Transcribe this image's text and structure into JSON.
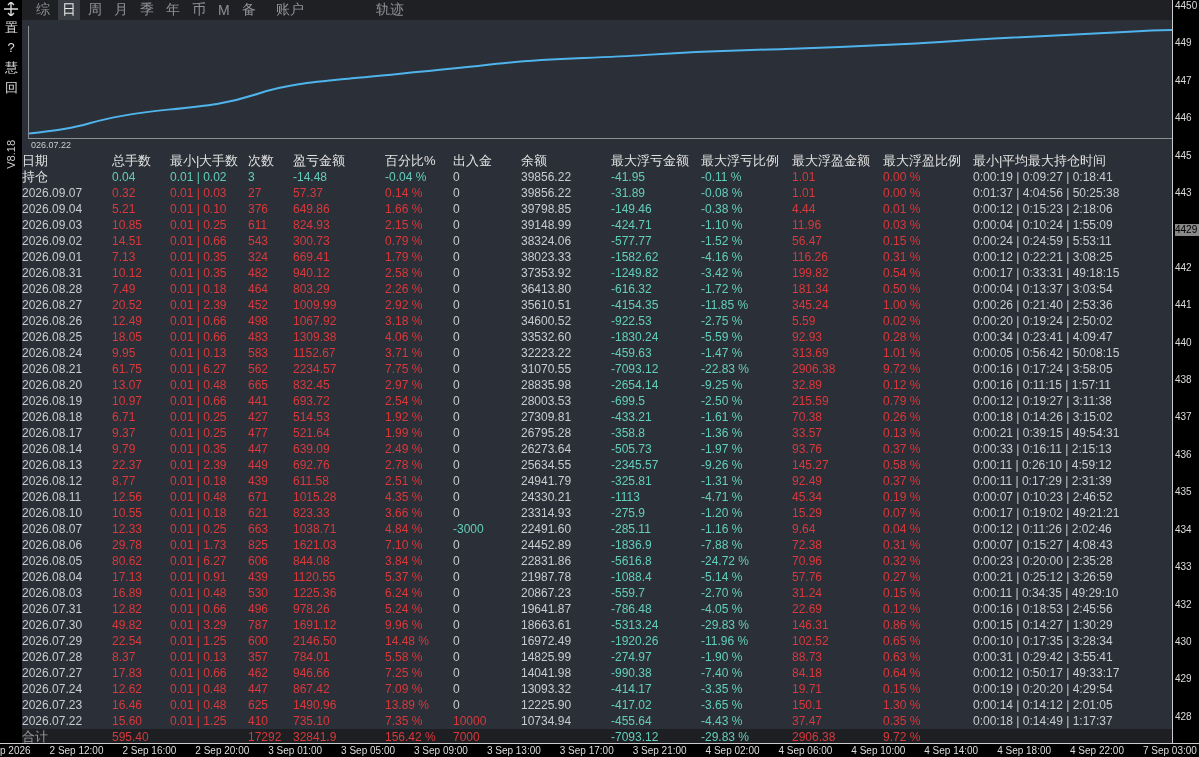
{
  "tabs": [
    {
      "label": "综",
      "selected": false
    },
    {
      "label": "日",
      "selected": true
    },
    {
      "label": "周",
      "selected": false
    },
    {
      "label": "月",
      "selected": false
    },
    {
      "label": "季",
      "selected": false
    },
    {
      "label": "年",
      "selected": false
    },
    {
      "label": "币",
      "selected": false
    },
    {
      "label": "M",
      "selected": false
    },
    {
      "label": "备",
      "selected": false
    },
    {
      "label": "账户",
      "selected": false
    },
    {
      "label": "轨迹",
      "selected": false
    }
  ],
  "left_toolbar": [
    "置",
    "?",
    "慧",
    "回"
  ],
  "version": "V8.18",
  "chart": {
    "start_label": "026.07.22"
  },
  "table": {
    "columns": [
      "日期",
      "总手数",
      "最小|大手数",
      "次数",
      "盈亏金额",
      "百分比%",
      "出入金",
      "余额",
      "最大浮亏金额",
      "最大浮亏比例",
      "最大浮盈金额",
      "最大浮盈比例",
      "最小|平均最大持仓时间"
    ],
    "rows": [
      {
        "kind": "position",
        "cells": [
          "持仓",
          "0.04",
          "0.01 | 0.02",
          "3",
          "-14.48",
          "-0.04 %",
          "0",
          "39856.22",
          "-41.95",
          "-0.11 %",
          "1.01",
          "0.00 %",
          "0:00:19 | 0:09:27 | 0:18:41"
        ]
      },
      {
        "kind": "day",
        "cells": [
          "2026.09.07",
          "0.32",
          "0.01 | 0.03",
          "27",
          "57.37",
          "0.14 %",
          "0",
          "39856.22",
          "-31.89",
          "-0.08 %",
          "1.01",
          "0.00 %",
          "0:01:37 | 4:04:56 | 50:25:38"
        ]
      },
      {
        "kind": "day",
        "cells": [
          "2026.09.04",
          "5.21",
          "0.01 | 0.10",
          "376",
          "649.86",
          "1.66 %",
          "0",
          "39798.85",
          "-149.46",
          "-0.38 %",
          "4.44",
          "0.01 %",
          "0:00:12 | 0:15:23 | 2:18:06"
        ]
      },
      {
        "kind": "day",
        "cells": [
          "2026.09.03",
          "10.85",
          "0.01 | 0.25",
          "611",
          "824.93",
          "2.15 %",
          "0",
          "39148.99",
          "-424.71",
          "-1.10 %",
          "11.96",
          "0.03 %",
          "0:00:04 | 0:10:24 | 1:55:09"
        ]
      },
      {
        "kind": "day",
        "cells": [
          "2026.09.02",
          "14.51",
          "0.01 | 0.66",
          "543",
          "300.73",
          "0.79 %",
          "0",
          "38324.06",
          "-577.77",
          "-1.52 %",
          "56.47",
          "0.15 %",
          "0:00:24 | 0:24:59 | 5:53:11"
        ]
      },
      {
        "kind": "day",
        "cells": [
          "2026.09.01",
          "7.13",
          "0.01 | 0.35",
          "324",
          "669.41",
          "1.79 %",
          "0",
          "38023.33",
          "-1582.62",
          "-4.16 %",
          "116.26",
          "0.31 %",
          "0:00:12 | 0:22:21 | 3:08:25"
        ]
      },
      {
        "kind": "day",
        "cells": [
          "2026.08.31",
          "10.12",
          "0.01 | 0.35",
          "482",
          "940.12",
          "2.58 %",
          "0",
          "37353.92",
          "-1249.82",
          "-3.42 %",
          "199.82",
          "0.54 %",
          "0:00:17 | 0:33:31 | 49:18:15"
        ]
      },
      {
        "kind": "day",
        "cells": [
          "2026.08.28",
          "7.49",
          "0.01 | 0.18",
          "464",
          "803.29",
          "2.26 %",
          "0",
          "36413.80",
          "-616.32",
          "-1.72 %",
          "181.34",
          "0.50 %",
          "0:00:04 | 0:13:37 | 3:03:54"
        ]
      },
      {
        "kind": "day",
        "cells": [
          "2026.08.27",
          "20.52",
          "0.01 | 2.39",
          "452",
          "1009.99",
          "2.92 %",
          "0",
          "35610.51",
          "-4154.35",
          "-11.85 %",
          "345.24",
          "1.00 %",
          "0:00:26 | 0:21:40 | 2:53:36"
        ]
      },
      {
        "kind": "day",
        "cells": [
          "2026.08.26",
          "12.49",
          "0.01 | 0.66",
          "498",
          "1067.92",
          "3.18 %",
          "0",
          "34600.52",
          "-922.53",
          "-2.75 %",
          "5.59",
          "0.02 %",
          "0:00:20 | 0:19:24 | 2:50:02"
        ]
      },
      {
        "kind": "day",
        "cells": [
          "2026.08.25",
          "18.05",
          "0.01 | 0.66",
          "483",
          "1309.38",
          "4.06 %",
          "0",
          "33532.60",
          "-1830.24",
          "-5.59 %",
          "92.93",
          "0.28 %",
          "0:00:34 | 0:23:41 | 4:09:47"
        ]
      },
      {
        "kind": "day",
        "cells": [
          "2026.08.24",
          "9.95",
          "0.01 | 0.13",
          "583",
          "1152.67",
          "3.71 %",
          "0",
          "32223.22",
          "-459.63",
          "-1.47 %",
          "313.69",
          "1.01 %",
          "0:00:05 | 0:56:42 | 50:08:15"
        ]
      },
      {
        "kind": "day",
        "cells": [
          "2026.08.21",
          "61.75",
          "0.01 | 6.27",
          "562",
          "2234.57",
          "7.75 %",
          "0",
          "31070.55",
          "-7093.12",
          "-22.83 %",
          "2906.38",
          "9.72 %",
          "0:00:16 | 0:17:24 | 3:58:05"
        ]
      },
      {
        "kind": "day",
        "cells": [
          "2026.08.20",
          "13.07",
          "0.01 | 0.48",
          "665",
          "832.45",
          "2.97 %",
          "0",
          "28835.98",
          "-2654.14",
          "-9.25 %",
          "32.89",
          "0.12 %",
          "0:00:16 | 0:11:15 | 1:57:11"
        ]
      },
      {
        "kind": "day",
        "cells": [
          "2026.08.19",
          "10.97",
          "0.01 | 0.66",
          "441",
          "693.72",
          "2.54 %",
          "0",
          "28003.53",
          "-699.5",
          "-2.50 %",
          "215.59",
          "0.79 %",
          "0:00:12 | 0:19:27 | 3:11:38"
        ]
      },
      {
        "kind": "day",
        "cells": [
          "2026.08.18",
          "6.71",
          "0.01 | 0.25",
          "427",
          "514.53",
          "1.92 %",
          "0",
          "27309.81",
          "-433.21",
          "-1.61 %",
          "70.38",
          "0.26 %",
          "0:00:18 | 0:14:26 | 3:15:02"
        ]
      },
      {
        "kind": "day",
        "cells": [
          "2026.08.17",
          "9.37",
          "0.01 | 0.25",
          "477",
          "521.64",
          "1.99 %",
          "0",
          "26795.28",
          "-358.8",
          "-1.36 %",
          "33.57",
          "0.13 %",
          "0:00:21 | 0:39:15 | 49:54:31"
        ]
      },
      {
        "kind": "day",
        "cells": [
          "2026.08.14",
          "9.79",
          "0.01 | 0.35",
          "447",
          "639.09",
          "2.49 %",
          "0",
          "26273.64",
          "-505.73",
          "-1.97 %",
          "93.76",
          "0.37 %",
          "0:00:33 | 0:16:11 | 2:15:13"
        ]
      },
      {
        "kind": "day",
        "cells": [
          "2026.08.13",
          "22.37",
          "0.01 | 2.39",
          "449",
          "692.76",
          "2.78 %",
          "0",
          "25634.55",
          "-2345.57",
          "-9.26 %",
          "145.27",
          "0.58 %",
          "0:00:11 | 0:26:10 | 4:59:12"
        ]
      },
      {
        "kind": "day",
        "cells": [
          "2026.08.12",
          "8.77",
          "0.01 | 0.18",
          "439",
          "611.58",
          "2.51 %",
          "0",
          "24941.79",
          "-325.81",
          "-1.31 %",
          "92.49",
          "0.37 %",
          "0:00:11 | 0:17:29 | 2:31:39"
        ]
      },
      {
        "kind": "day",
        "cells": [
          "2026.08.11",
          "12.56",
          "0.01 | 0.48",
          "671",
          "1015.28",
          "4.35 %",
          "0",
          "24330.21",
          "-1113",
          "-4.71 %",
          "45.34",
          "0.19 %",
          "0:00:07 | 0:10:23 | 2:46:52"
        ]
      },
      {
        "kind": "day",
        "cells": [
          "2026.08.10",
          "10.55",
          "0.01 | 0.18",
          "621",
          "823.33",
          "3.66 %",
          "0",
          "23314.93",
          "-275.9",
          "-1.20 %",
          "15.29",
          "0.07 %",
          "0:00:17 | 0:19:02 | 49:21:21"
        ]
      },
      {
        "kind": "day",
        "color": "#63cdbb",
        "cells": [
          "2026.08.07",
          "12.33",
          "0.01 | 0.25",
          "663",
          "1038.71",
          "4.84 %",
          "-3000",
          "22491.60",
          "-285.11",
          "-1.16 %",
          "9.64",
          "0.04 %",
          "0:00:12 | 0:11:26 | 2:02:46"
        ]
      },
      {
        "kind": "day",
        "cells": [
          "2026.08.06",
          "29.78",
          "0.01 | 1.73",
          "825",
          "1621.03",
          "7.10 %",
          "0",
          "24452.89",
          "-1836.9",
          "-7.88 %",
          "72.38",
          "0.31 %",
          "0:00:07 | 0:15:27 | 4:08:43"
        ]
      },
      {
        "kind": "day",
        "cells": [
          "2026.08.05",
          "80.62",
          "0.01 | 6.27",
          "606",
          "844.08",
          "3.84 %",
          "0",
          "22831.86",
          "-5616.8",
          "-24.72 %",
          "70.96",
          "0.32 %",
          "0:00:23 | 0:20:00 | 2:35:28"
        ]
      },
      {
        "kind": "day",
        "cells": [
          "2026.08.04",
          "17.13",
          "0.01 | 0.91",
          "439",
          "1120.55",
          "5.37 %",
          "0",
          "21987.78",
          "-1088.4",
          "-5.14 %",
          "57.76",
          "0.27 %",
          "0:00:21 | 0:25:12 | 3:26:59"
        ]
      },
      {
        "kind": "day",
        "cells": [
          "2026.08.03",
          "16.89",
          "0.01 | 0.48",
          "530",
          "1225.36",
          "6.24 %",
          "0",
          "20867.23",
          "-559.7",
          "-2.70 %",
          "31.24",
          "0.15 %",
          "0:00:11 | 0:34:35 | 49:29:10"
        ]
      },
      {
        "kind": "day",
        "cells": [
          "2026.07.31",
          "12.82",
          "0.01 | 0.66",
          "496",
          "978.26",
          "5.24 %",
          "0",
          "19641.87",
          "-786.48",
          "-4.05 %",
          "22.69",
          "0.12 %",
          "0:00:16 | 0:18:53 | 2:45:56"
        ]
      },
      {
        "kind": "day",
        "cells": [
          "2026.07.30",
          "49.82",
          "0.01 | 3.29",
          "787",
          "1691.12",
          "9.96 %",
          "0",
          "18663.61",
          "-5313.24",
          "-29.83 %",
          "146.31",
          "0.86 %",
          "0:00:15 | 0:14:27 | 1:30:29"
        ]
      },
      {
        "kind": "day",
        "cells": [
          "2026.07.29",
          "22.54",
          "0.01 | 1.25",
          "600",
          "2146.50",
          "14.48 %",
          "0",
          "16972.49",
          "-1920.26",
          "-11.96 %",
          "102.52",
          "0.65 %",
          "0:00:10 | 0:17:35 | 3:28:34"
        ]
      },
      {
        "kind": "day",
        "cells": [
          "2026.07.28",
          "8.37",
          "0.01 | 0.13",
          "357",
          "784.01",
          "5.58 %",
          "0",
          "14825.99",
          "-274.97",
          "-1.90 %",
          "88.73",
          "0.63 %",
          "0:00:31 | 0:29:42 | 3:55:41"
        ]
      },
      {
        "kind": "day",
        "cells": [
          "2026.07.27",
          "17.83",
          "0.01 | 0.66",
          "462",
          "946.66",
          "7.25 %",
          "0",
          "14041.98",
          "-990.38",
          "-7.40 %",
          "84.18",
          "0.64 %",
          "0:00:12 | 0:50:17 | 49:33:17"
        ]
      },
      {
        "kind": "day",
        "cells": [
          "2026.07.24",
          "12.62",
          "0.01 | 0.48",
          "447",
          "867.42",
          "7.09 %",
          "0",
          "13093.32",
          "-414.17",
          "-3.35 %",
          "19.71",
          "0.15 %",
          "0:00:19 | 0:20:20 | 4:29:54"
        ]
      },
      {
        "kind": "day",
        "cells": [
          "2026.07.23",
          "16.46",
          "0.01 | 0.48",
          "625",
          "1490.96",
          "13.89 %",
          "0",
          "12225.90",
          "-417.02",
          "-3.65 %",
          "150.1",
          "1.30 %",
          "0:00:14 | 0:14:12 | 2:01:05"
        ]
      },
      {
        "kind": "day",
        "color": "#d8393b",
        "cells": [
          "2026.07.22",
          "15.60",
          "0.01 | 1.25",
          "410",
          "735.10",
          "7.35 %",
          "10000",
          "10734.94",
          "-455.64",
          "-4.43 %",
          "37.47",
          "0.35 %",
          "0:00:18 | 0:14:49 | 1:17:37"
        ]
      },
      {
        "kind": "total",
        "color": "#d8393b",
        "cells": [
          "合计",
          "595.40",
          null,
          "17292",
          "32841.9",
          "156.42 %",
          "7000",
          null,
          "-7093.12",
          "-29.83 %",
          "2906.38",
          "9.72 %",
          null
        ]
      }
    ]
  },
  "price_axis": [
    "4450",
    "449",
    "447",
    "446",
    "445",
    "443",
    "4429",
    "442",
    "441",
    "440",
    "438",
    "437",
    "436",
    "435",
    "434",
    "433",
    "432",
    "430",
    "429",
    "428"
  ],
  "time_axis": [
    "p 2026",
    "2 Sep 12:00",
    "2 Sep 16:00",
    "2 Sep 20:00",
    "3 Sep 01:00",
    "3 Sep 05:00",
    "3 Sep 09:00",
    "3 Sep 13:00",
    "3 Sep 17:00",
    "3 Sep 21:00",
    "4 Sep 02:00",
    "4 Sep 06:00",
    "4 Sep 10:00",
    "4 Sep 14:00",
    "4 Sep 18:00",
    "4 Sep 22:00",
    "7 Sep 03:00"
  ]
}
